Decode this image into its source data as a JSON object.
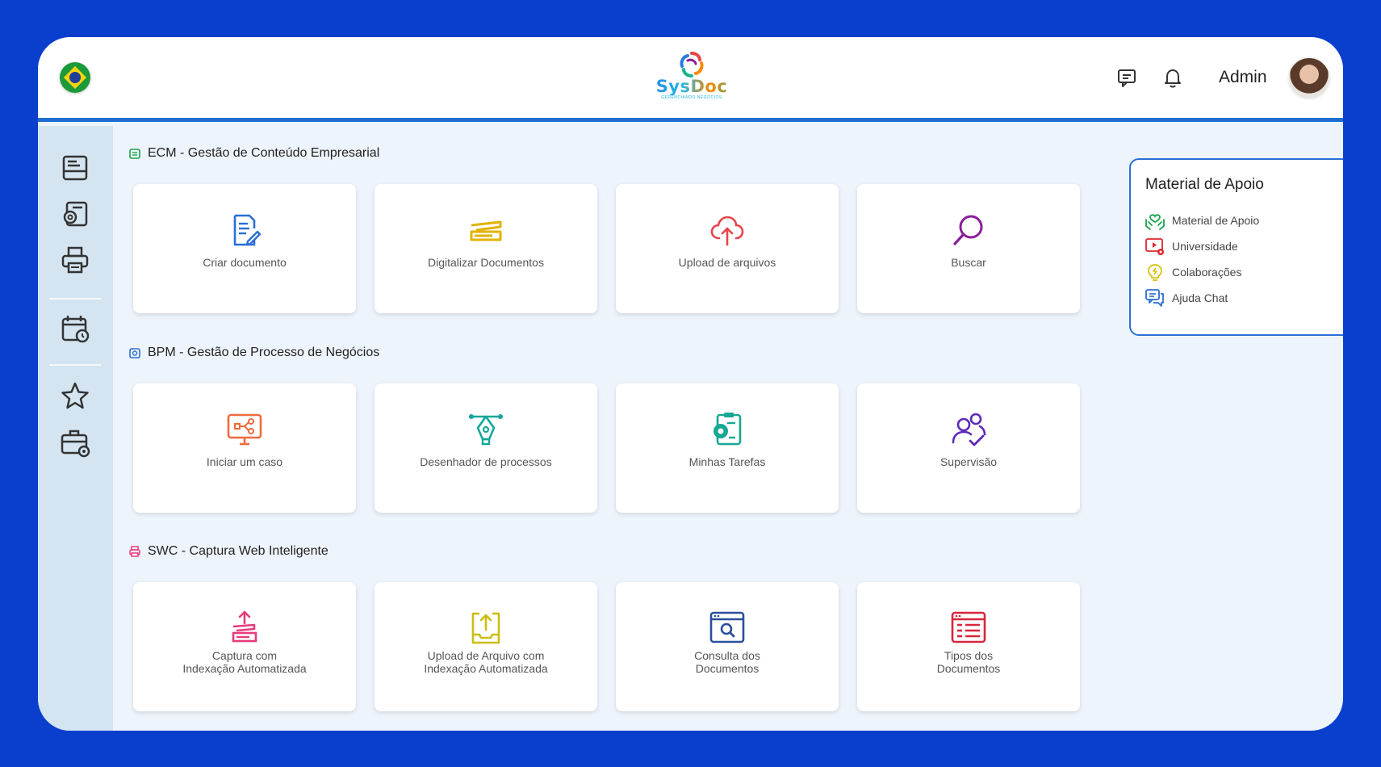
{
  "header": {
    "brand": "SysDoc",
    "tagline": "GERENCIANDO NEGÓCIOS",
    "user_name": "Admin",
    "icons": [
      "brazil-flag-icon",
      "chat-icon",
      "bell-icon"
    ]
  },
  "sidebar": {
    "items": [
      "inbox-icon",
      "settings-document-icon",
      "printer-icon",
      "calendar-clock-icon",
      "star-icon",
      "briefcase-gear-icon"
    ]
  },
  "sections": [
    {
      "title": "ECM - Gestão de Conteúdo Empresarial",
      "cards": [
        {
          "label": "Criar documento",
          "icon": "edit-document-icon",
          "color": "#2a6fd6"
        },
        {
          "label": "Digitalizar Documentos",
          "icon": "scanner-icon",
          "color": "#e3b200"
        },
        {
          "label": "Upload de arquivos",
          "icon": "cloud-upload-icon",
          "color": "#e8444a"
        },
        {
          "label": "Buscar",
          "icon": "search-icon",
          "color": "#8a1f9b"
        }
      ]
    },
    {
      "title": "BPM - Gestão de Processo de Negócios",
      "cards": [
        {
          "label": "Iniciar um caso",
          "icon": "monitor-workflow-icon",
          "color": "#f06a3c"
        },
        {
          "label": "Desenhador de processos",
          "icon": "pen-tool-icon",
          "color": "#12a79a"
        },
        {
          "label": "Minhas Tarefas",
          "icon": "clipboard-gear-icon",
          "color": "#17a894"
        },
        {
          "label": "Supervisão",
          "icon": "users-check-icon",
          "color": "#5b2bb8"
        }
      ]
    },
    {
      "title": "SWC - Captura Web Inteligente",
      "cards": [
        {
          "label": "Captura com\nIndexação Automatizada",
          "icon": "capture-upload-icon",
          "color": "#e63c7e"
        },
        {
          "label": "Upload de Arquivo com\nIndexação Automatizada",
          "icon": "tray-upload-icon",
          "color": "#cbbd12"
        },
        {
          "label": "Consulta dos\nDocumentos",
          "icon": "browser-search-icon",
          "color": "#2a4f9e"
        },
        {
          "label": "Tipos dos\nDocumentos",
          "icon": "list-window-icon",
          "color": "#d7263d"
        }
      ]
    }
  ],
  "apoio": {
    "title": "Material de Apoio",
    "items": [
      {
        "label": "Material de Apoio",
        "icon": "hands-heart-icon",
        "color": "#1aa34a"
      },
      {
        "label": "Universidade",
        "icon": "video-gear-icon",
        "color": "#e0262e"
      },
      {
        "label": "Colaborações",
        "icon": "lightbulb-icon",
        "color": "#d5c20a"
      },
      {
        "label": "Ajuda Chat",
        "icon": "chat-bubbles-icon",
        "color": "#2a6fd6"
      }
    ]
  }
}
